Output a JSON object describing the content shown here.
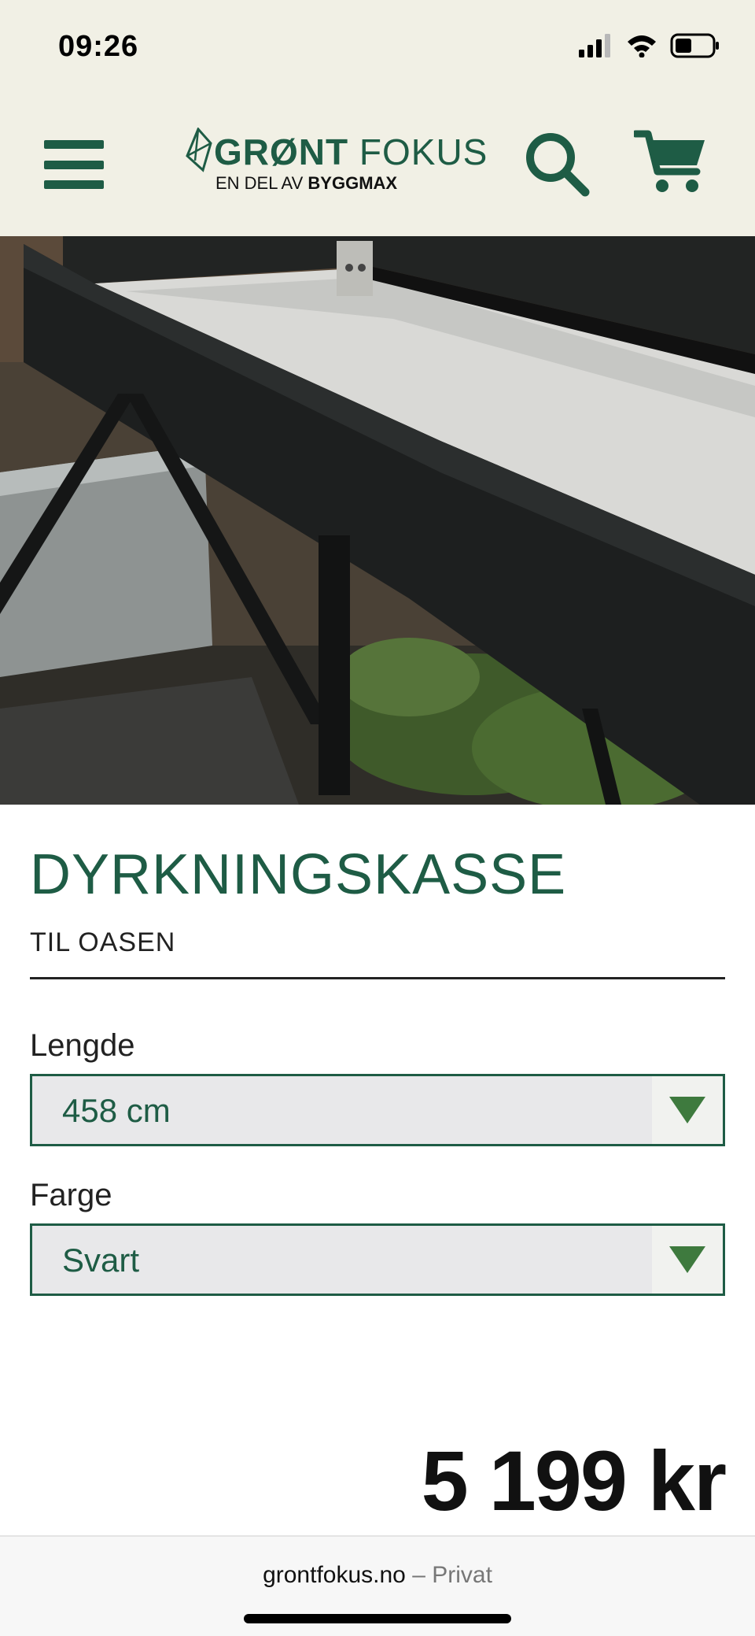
{
  "status_bar": {
    "time": "09:26"
  },
  "header": {
    "logo": {
      "name_bold": "GRØNT",
      "name_light": "FOKUS",
      "tagline_light": "EN DEL AV",
      "tagline_bold": "BYGGMAX"
    }
  },
  "product": {
    "title": "DYRKNINGSKASSE",
    "subtitle": "TIL OASEN",
    "options": [
      {
        "label": "Lengde",
        "value": "458 cm"
      },
      {
        "label": "Farge",
        "value": "Svart"
      }
    ],
    "price": "5 199 kr"
  },
  "browser": {
    "domain": "grontfokus.no",
    "separator": "–",
    "mode": "Privat"
  },
  "colors": {
    "brand_green": "#1e5c45",
    "header_bg": "#f1f0e5",
    "arrow_green": "#3e7a3e"
  }
}
